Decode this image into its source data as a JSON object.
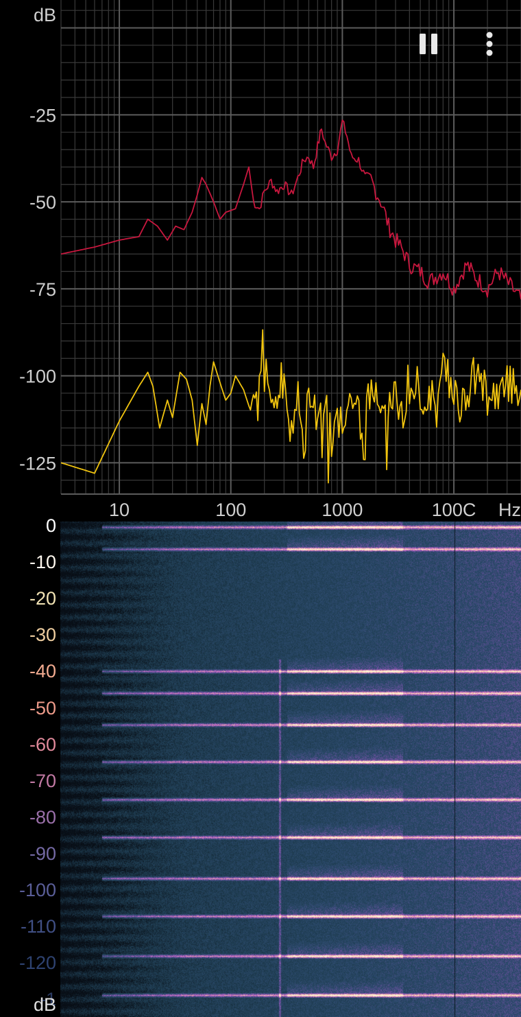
{
  "spectrum": {
    "y_unit": "dB",
    "y_ticks": [
      "-25",
      "-50",
      "-75",
      "-100",
      "-125"
    ],
    "x_ticks": [
      "10",
      "100",
      "1000",
      "100C"
    ],
    "x_unit": "Hz",
    "colors": {
      "channel_1": "#c8173e",
      "channel_2": "#f1c40f",
      "grid": "#3a3a3a",
      "grid_major": "#5c5c5c"
    }
  },
  "chart_data": {
    "type": "line",
    "xscale": "log",
    "xlim": [
      3,
      40000
    ],
    "ylim": [
      -134,
      8
    ],
    "xlabel": "Hz",
    "ylabel": "dB",
    "series": [
      {
        "color": "#c8173e",
        "x": [
          3,
          6,
          10,
          15,
          18,
          22,
          27,
          32,
          38,
          45,
          50,
          55,
          60,
          70,
          80,
          90,
          110,
          130,
          145,
          160,
          180,
          200,
          230,
          260,
          300,
          350,
          400,
          450,
          500,
          550,
          600,
          650,
          700,
          800,
          900,
          1000,
          1100,
          1200,
          1400,
          1600,
          1800,
          2000,
          2300,
          2600,
          3000,
          3500,
          4000,
          5000,
          6000,
          8000,
          10000,
          13000,
          16000,
          20000,
          25000,
          30000,
          40000
        ],
        "y": [
          -65,
          -63,
          -61,
          -60,
          -55,
          -57,
          -61,
          -57,
          -58,
          -53,
          -48,
          -43,
          -45,
          -50,
          -55,
          -53,
          -52,
          -45,
          -40,
          -50,
          -52,
          -47,
          -44,
          -47,
          -45,
          -48,
          -43,
          -38,
          -37,
          -40,
          -34,
          -29,
          -33,
          -37,
          -35,
          -27,
          -31,
          -37,
          -38,
          -43,
          -43,
          -47,
          -51,
          -57,
          -61,
          -64,
          -68,
          -70,
          -73,
          -70,
          -75,
          -68,
          -72,
          -75,
          -70,
          -73,
          -78
        ]
      },
      {
        "color": "#f1c40f",
        "x": [
          3,
          6,
          10,
          15,
          18,
          20,
          23,
          27,
          30,
          35,
          40,
          45,
          50,
          55,
          60,
          65,
          70,
          80,
          90,
          100,
          110,
          130,
          150,
          180,
          200,
          230,
          260,
          300,
          350,
          400,
          450,
          500,
          600,
          700,
          800,
          900,
          1000,
          1200,
          1500,
          2000,
          2500,
          3000,
          3500,
          4000,
          5000,
          6000,
          7000,
          8000,
          10000,
          12000,
          15000,
          20000,
          25000,
          30000,
          40000
        ],
        "y": [
          -125,
          -128,
          -113,
          -103,
          -99,
          -103,
          -115,
          -107,
          -112,
          -99,
          -101,
          -107,
          -120,
          -108,
          -114,
          -103,
          -96,
          -102,
          -107,
          -105,
          -100,
          -104,
          -110,
          -102,
          -94,
          -106,
          -112,
          -102,
          -118,
          -104,
          -124,
          -103,
          -112,
          -104,
          -118,
          -104,
          -112,
          -106,
          -111,
          -103,
          -108,
          -104,
          -112,
          -106,
          -109,
          -104,
          -110,
          -98,
          -104,
          -108,
          -100,
          -104,
          -106,
          -102,
          -104
        ]
      }
    ]
  },
  "spectrogram": {
    "y_ticks": [
      "0",
      "-10",
      "-20",
      "-30",
      "-40",
      "-50",
      "-60",
      "-70",
      "-80",
      "-90",
      "-100",
      "-110",
      "-120",
      "-1"
    ],
    "y_unit": "dB",
    "tick_colors": [
      "#ffffff",
      "#fff8ee",
      "#f2e3b4",
      "#efcea0",
      "#f2ab90",
      "#ee9b8a",
      "#e0899a",
      "#c27aa4",
      "#9b70aa",
      "#7469a4",
      "#5a5e98",
      "#404f84",
      "#2e4270",
      "#2a3a60"
    ]
  },
  "toolbar": {
    "pause_icon": "pause-icon",
    "menu_icon": "more-vert-icon"
  }
}
